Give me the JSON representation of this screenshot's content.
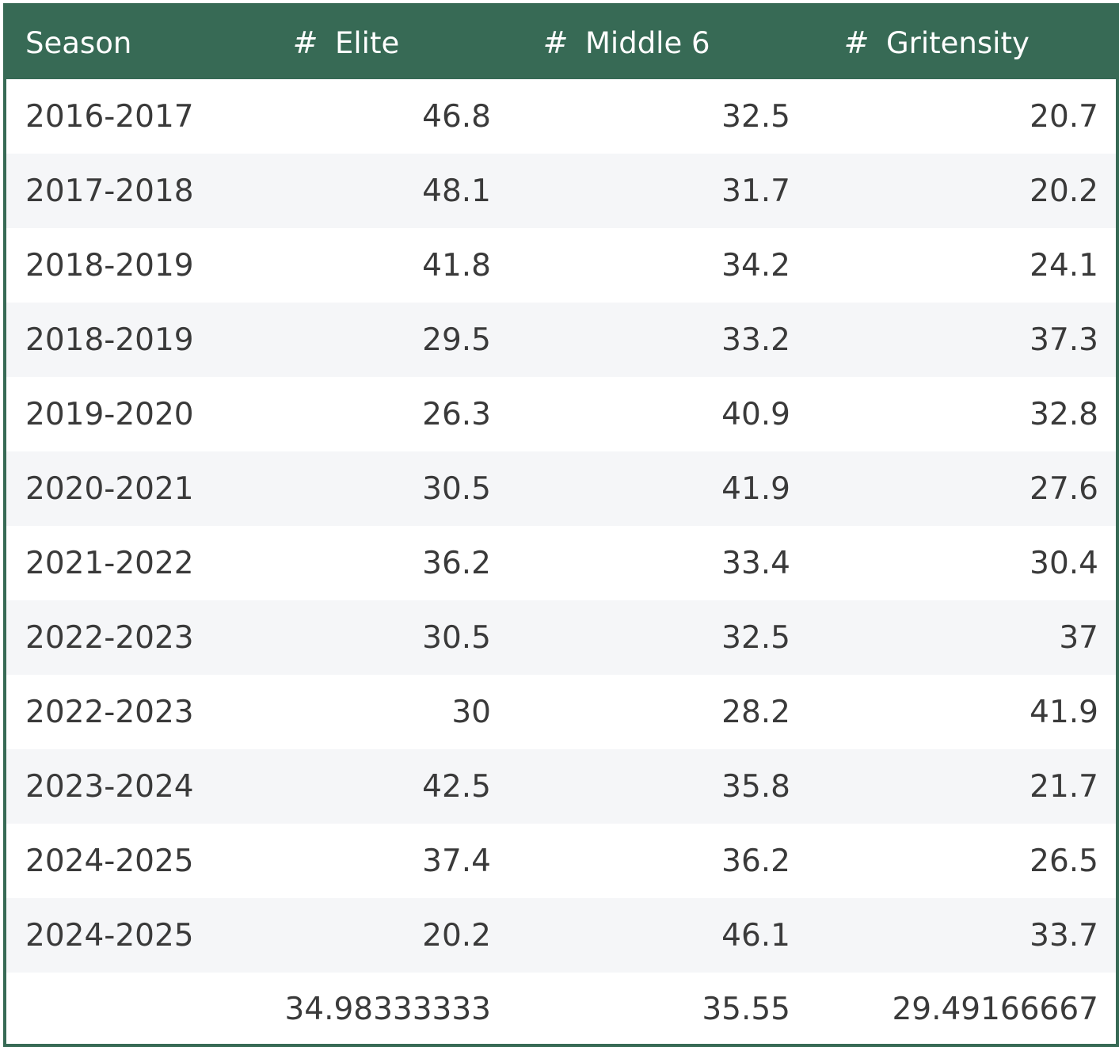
{
  "chart_data": {
    "type": "table",
    "columns": [
      {
        "label": "Season",
        "prefix": ""
      },
      {
        "label": "Elite",
        "prefix": "#"
      },
      {
        "label": "Middle 6",
        "prefix": "#"
      },
      {
        "label": "Gritensity",
        "prefix": "#"
      }
    ],
    "rows": [
      [
        "2016-2017",
        "46.8",
        "32.5",
        "20.7"
      ],
      [
        "2017-2018",
        "48.1",
        "31.7",
        "20.2"
      ],
      [
        "2018-2019",
        "41.8",
        "34.2",
        "24.1"
      ],
      [
        "2018-2019",
        "29.5",
        "33.2",
        "37.3"
      ],
      [
        "2019-2020",
        "26.3",
        "40.9",
        "32.8"
      ],
      [
        "2020-2021",
        "30.5",
        "41.9",
        "27.6"
      ],
      [
        "2021-2022",
        "36.2",
        "33.4",
        "30.4"
      ],
      [
        "2022-2023",
        "30.5",
        "32.5",
        "37"
      ],
      [
        "2022-2023",
        "30",
        "28.2",
        "41.9"
      ],
      [
        "2023-2024",
        "42.5",
        "35.8",
        "21.7"
      ],
      [
        "2024-2025",
        "37.4",
        "36.2",
        "26.5"
      ],
      [
        "2024-2025",
        "20.2",
        "46.1",
        "33.7"
      ]
    ],
    "footer": [
      "",
      "34.98333333",
      "35.55",
      "29.49166667"
    ]
  },
  "colors": {
    "header_bg": "#376a55",
    "header_text": "#ffffff",
    "row_alt_bg": "#f5f6f8",
    "cell_text": "#3a3a3a"
  }
}
